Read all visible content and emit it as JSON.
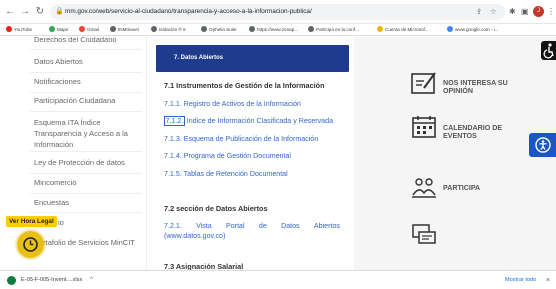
{
  "browser": {
    "url": "mm.gov.co/web/servicio-al-ciudadano/transparencia-y-acceso-a-la-informacion-publica/",
    "profile_initial": "J",
    "bookmarks": [
      "YouTube",
      "Maps",
      "Gmail",
      "INMInavel",
      "Isolación ® 5",
      "Ophelia Suite",
      "https://www.zonap...",
      "Participa en la conf...",
      "Cuenta de Microsof...",
      "www.google.com - i..."
    ]
  },
  "left_nav": {
    "items": [
      "Derechos del Ciudadano",
      "Datos Abiertos",
      "Notificaciones",
      "Participación Ciudadana",
      "Esquema ITA Índice Transparencia y Acceso a la Información",
      "Ley de Protección de datos",
      "Mincomercio",
      "Encuestas",
      "io",
      "Portafolio de Servicios MinCIT"
    ],
    "hora_legal_label": "Ver Hora Legal"
  },
  "content": {
    "header": "7. Datos Abiertos",
    "section_1_title": "7.1 Instrumentos de Gestión de la Información",
    "links": [
      {
        "num": "7.1.1.",
        "text": "Registro de Activos de la Información"
      },
      {
        "num": "7.1.2.",
        "text": "Indice de Información Clasificada y Reservada"
      },
      {
        "num": "7.1.3.",
        "text": "Esquema de Publicación de la Información"
      },
      {
        "num": "7.1.4.",
        "text": "Programa de Gestión Documental"
      },
      {
        "num": "7.1.5.",
        "text": "Tablas de Retención Documental"
      }
    ],
    "section_2_title": "7.2 sección de Datos Abiertos",
    "link_721": {
      "line1_words": [
        "7.2.1.",
        "Vista",
        "Portal",
        "de",
        "Datos",
        "Abiertos"
      ],
      "line2": "(www.datos.gov.co)"
    },
    "section_3_title": "7.3 Asignación Salarial"
  },
  "right_column": {
    "items": [
      {
        "label_line1": "NOS INTERESA SU",
        "label_line2": "OPINIÓN",
        "icon": "feedback-icon"
      },
      {
        "label_line1": "CALENDARIO DE",
        "label_line2": "EVENTOS",
        "icon": "calendar-icon"
      },
      {
        "label_line1": "PARTICIPA",
        "label_line2": "",
        "icon": "participa-icon"
      },
      {
        "label_line1": "",
        "label_line2": "",
        "icon": "chat-icon"
      }
    ]
  },
  "downloads": {
    "file_name": "E-05-F-005-Invent....xlsx",
    "show_all": "Mostrar todo"
  },
  "colors": {
    "header_blue": "#1f3c8c",
    "link_blue": "#3366cc",
    "hora_legal_yellow": "#ffcc00",
    "accessibility_blue": "#1a56c4"
  }
}
